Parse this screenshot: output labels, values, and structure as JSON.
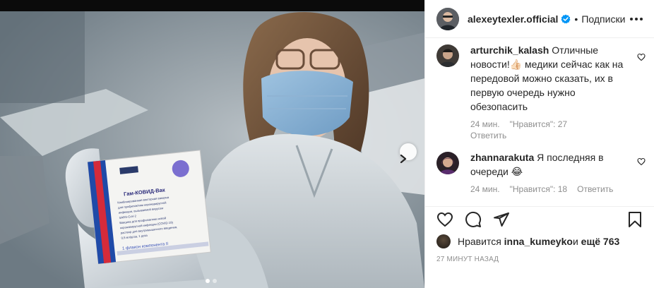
{
  "post": {
    "author": "alexeytexler.official",
    "separator": "•",
    "follow_label": "Подписки",
    "verified_icon": "verified-badge-icon",
    "accent": "#0095f6"
  },
  "comments": [
    {
      "username": "arturchik_kalash",
      "text_before_emoji": "Отличные новости!",
      "emoji": "👍🏻",
      "text_after_emoji": " медики сейчас как на передовой можно сказать, их в первую очередь нужно обезопасить",
      "time": "24 мин.",
      "likes": "\"Нравится\": 27",
      "reply_label": "Ответить"
    },
    {
      "username": "zhannarakuta",
      "text_before_emoji": "Я последняя в очереди ",
      "emoji": "😂",
      "text_after_emoji": "",
      "time": "24 мин.",
      "likes": "\"Нравится\": 18",
      "reply_label": "Ответить"
    }
  ],
  "liked_by": {
    "prefix": "Нравится ",
    "user": "inna_kumeyko",
    "middle": " и ",
    "others": "ещё 763"
  },
  "timestamp": "27 МИНУТ НАЗАД",
  "media": {
    "carousel_pages": 2,
    "current_page": 1,
    "box_brand": "Гам-КОВИД-Вак",
    "box_lines": [
      "Комбинированная векторная вакцина",
      "для профилактики коронавирусной",
      "инфекции, вызываемой вирусом",
      "SARS-CoV-2",
      "Вакцина для профилактики новой",
      "коронавирусной инфекции (COVID-19)",
      "раствор для внутримышечного введения,",
      "0,5 мл/доза, 1 доза",
      "1 флакон компонента II"
    ]
  }
}
